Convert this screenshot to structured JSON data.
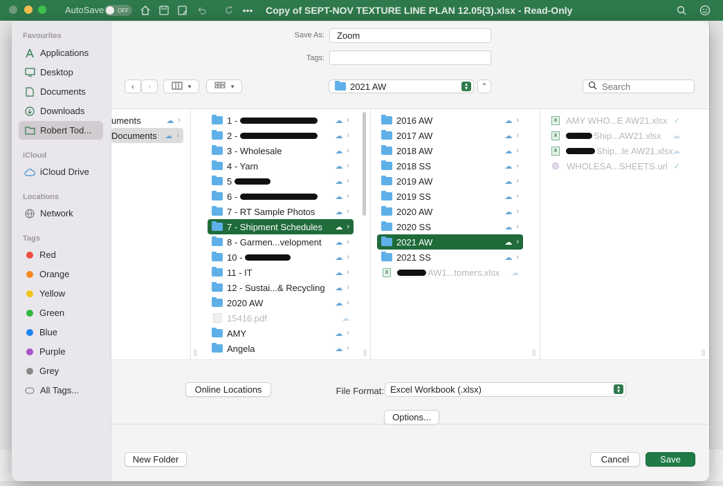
{
  "excel": {
    "autosave_label": "AutoSave",
    "autosave_state": "OFF",
    "doc_title": "Copy of SEPT-NOV TEXTURE LINE PLAN 12.05(3).xlsx  -  Read-Only"
  },
  "sidebar": {
    "favourites_label": "Favourites",
    "favourites": [
      {
        "label": "Applications",
        "icon": "applications-icon"
      },
      {
        "label": "Desktop",
        "icon": "desktop-icon"
      },
      {
        "label": "Documents",
        "icon": "document-icon"
      },
      {
        "label": "Downloads",
        "icon": "downloads-icon"
      },
      {
        "label": "Robert Tod...",
        "icon": "folder-icon"
      }
    ],
    "icloud_label": "iCloud",
    "icloud": [
      {
        "label": "iCloud Drive",
        "icon": "cloud-icon"
      }
    ],
    "locations_label": "Locations",
    "locations": [
      {
        "label": "Network",
        "icon": "globe-icon"
      }
    ],
    "tags_label": "Tags",
    "tags": [
      {
        "label": "Red",
        "color": "#f04a3e"
      },
      {
        "label": "Orange",
        "color": "#f4891f"
      },
      {
        "label": "Yellow",
        "color": "#f3c21a"
      },
      {
        "label": "Green",
        "color": "#33b83f"
      },
      {
        "label": "Blue",
        "color": "#1f86f2"
      },
      {
        "label": "Purple",
        "color": "#a551c7"
      },
      {
        "label": "Grey",
        "color": "#8a8a8a"
      },
      {
        "label": "All Tags..."
      }
    ]
  },
  "form": {
    "save_as_label": "Save As:",
    "save_as_value": "Zoom",
    "tags_label": "Tags:",
    "location": "2021 AW",
    "search_placeholder": "Search"
  },
  "columns": {
    "col1": [
      {
        "label": "uments"
      },
      {
        "label": "Documents"
      }
    ],
    "col2": [
      {
        "label": "1 -"
      },
      {
        "label": "2 -"
      },
      {
        "label": "3 - Wholesale"
      },
      {
        "label": "4 - Yarn"
      },
      {
        "label": "5"
      },
      {
        "label": "6 -"
      },
      {
        "label": "7 - RT Sample Photos"
      },
      {
        "label": "7 - Shipment Schedules"
      },
      {
        "label": "8 - Garmen...velopment"
      },
      {
        "label": "10 -"
      },
      {
        "label": "11 - IT"
      },
      {
        "label": "12 - Sustai...& Recycling"
      },
      {
        "label": "2020 AW"
      },
      {
        "label": "15416.pdf"
      },
      {
        "label": "AMY"
      },
      {
        "label": "Angela"
      }
    ],
    "col3": [
      {
        "label": "2016 AW"
      },
      {
        "label": "2017 AW"
      },
      {
        "label": "2018 AW"
      },
      {
        "label": "2018 SS"
      },
      {
        "label": "2019 AW"
      },
      {
        "label": "2019 SS"
      },
      {
        "label": "2020 AW"
      },
      {
        "label": "2020 SS"
      },
      {
        "label": "2021 AW"
      },
      {
        "label": "2021 SS"
      },
      {
        "label": "AW1...tomers.xlsx"
      }
    ],
    "col4": [
      {
        "label": "AMY WHO...E AW21.xlsx"
      },
      {
        "label": "Ship...AW21.xlsx"
      },
      {
        "label": "Ship...le AW21.xlsx"
      },
      {
        "label": "WHOLESA...SHEETS.url"
      }
    ]
  },
  "footer": {
    "online_locations": "Online Locations",
    "file_format_label": "File Format:",
    "file_format_value": "Excel Workbook (.xlsx)",
    "options": "Options...",
    "new_folder": "New Folder",
    "cancel": "Cancel",
    "save": "Save"
  }
}
